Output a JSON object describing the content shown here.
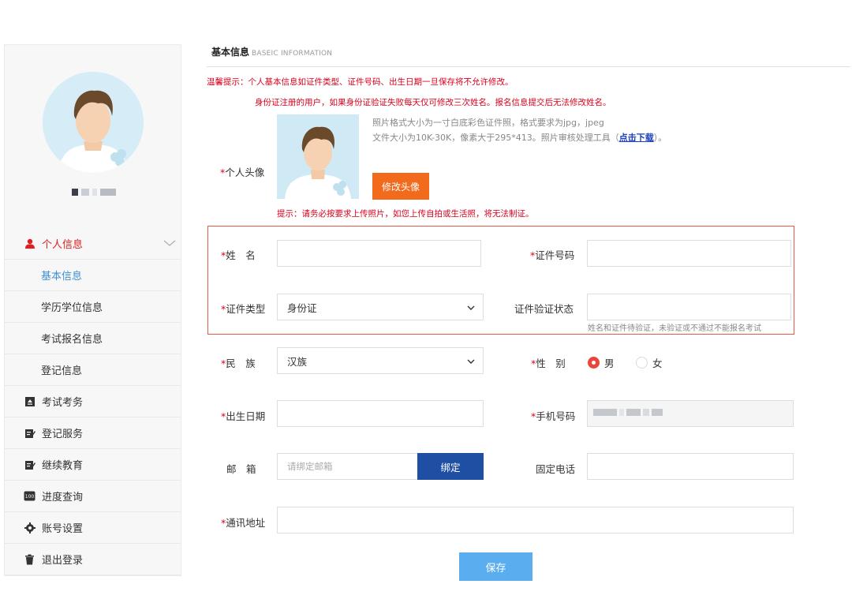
{
  "sidebar": {
    "menu": {
      "personal_info": "个人信息",
      "sub_items": [
        "基本信息",
        "学历学位信息",
        "考试报名信息",
        "登记信息"
      ],
      "exam": "考试考务",
      "register_service": "登记服务",
      "continuing_edu": "继续教育",
      "progress": "进度查询",
      "account_settings": "账号设置",
      "logout": "退出登录"
    }
  },
  "main": {
    "title": "基本信息",
    "title_en": "BASEIC INFORMATION",
    "notice_line1": "温馨提示：个人基本信息如证件类型、证件号码、出生日期一旦保存将不允许修改。",
    "notice_line2": "身份证注册的用户，如果身份证验证失败每天仅可修改三次姓名。报名信息提交后无法修改姓名。",
    "photo": {
      "label": "个人头像",
      "tip1": "照片格式大小为一寸白底彩色证件照，格式要求为jpg，jpeg",
      "tip2_prefix": "文件大小为10K-30K，像素大于295*413。照片审核处理工具（",
      "tip2_link": "点击下载",
      "tip2_suffix": "）。",
      "change_button": "修改头像",
      "warning": "提示：请务必按要求上传照片，如您上传自拍或生活照，将无法制证。"
    },
    "form": {
      "name_label": "姓　名",
      "id_number_label": "证件号码",
      "id_type_label": "证件类型",
      "id_type_value": "身份证",
      "verify_status_label": "证件验证状态",
      "verify_hint": "姓名和证件待验证，未验证或不通过不能报名考试",
      "ethnicity_label": "民　族",
      "ethnicity_value": "汉族",
      "gender_label": "性　别",
      "gender_male": "男",
      "gender_female": "女",
      "birth_label": "出生日期",
      "phone_label": "手机号码",
      "email_label": "邮　箱",
      "email_placeholder": "请绑定邮箱",
      "bind_button": "绑定",
      "landline_label": "固定电话",
      "address_label": "通讯地址",
      "save_button": "保存",
      "required_mark": "*"
    }
  },
  "colors": {
    "accent_red": "#d9001b",
    "orange_button": "#f26a1b",
    "bind_button": "#1f4fa3",
    "save_button": "#5aaef0",
    "active_sub": "#3d8fd6"
  }
}
